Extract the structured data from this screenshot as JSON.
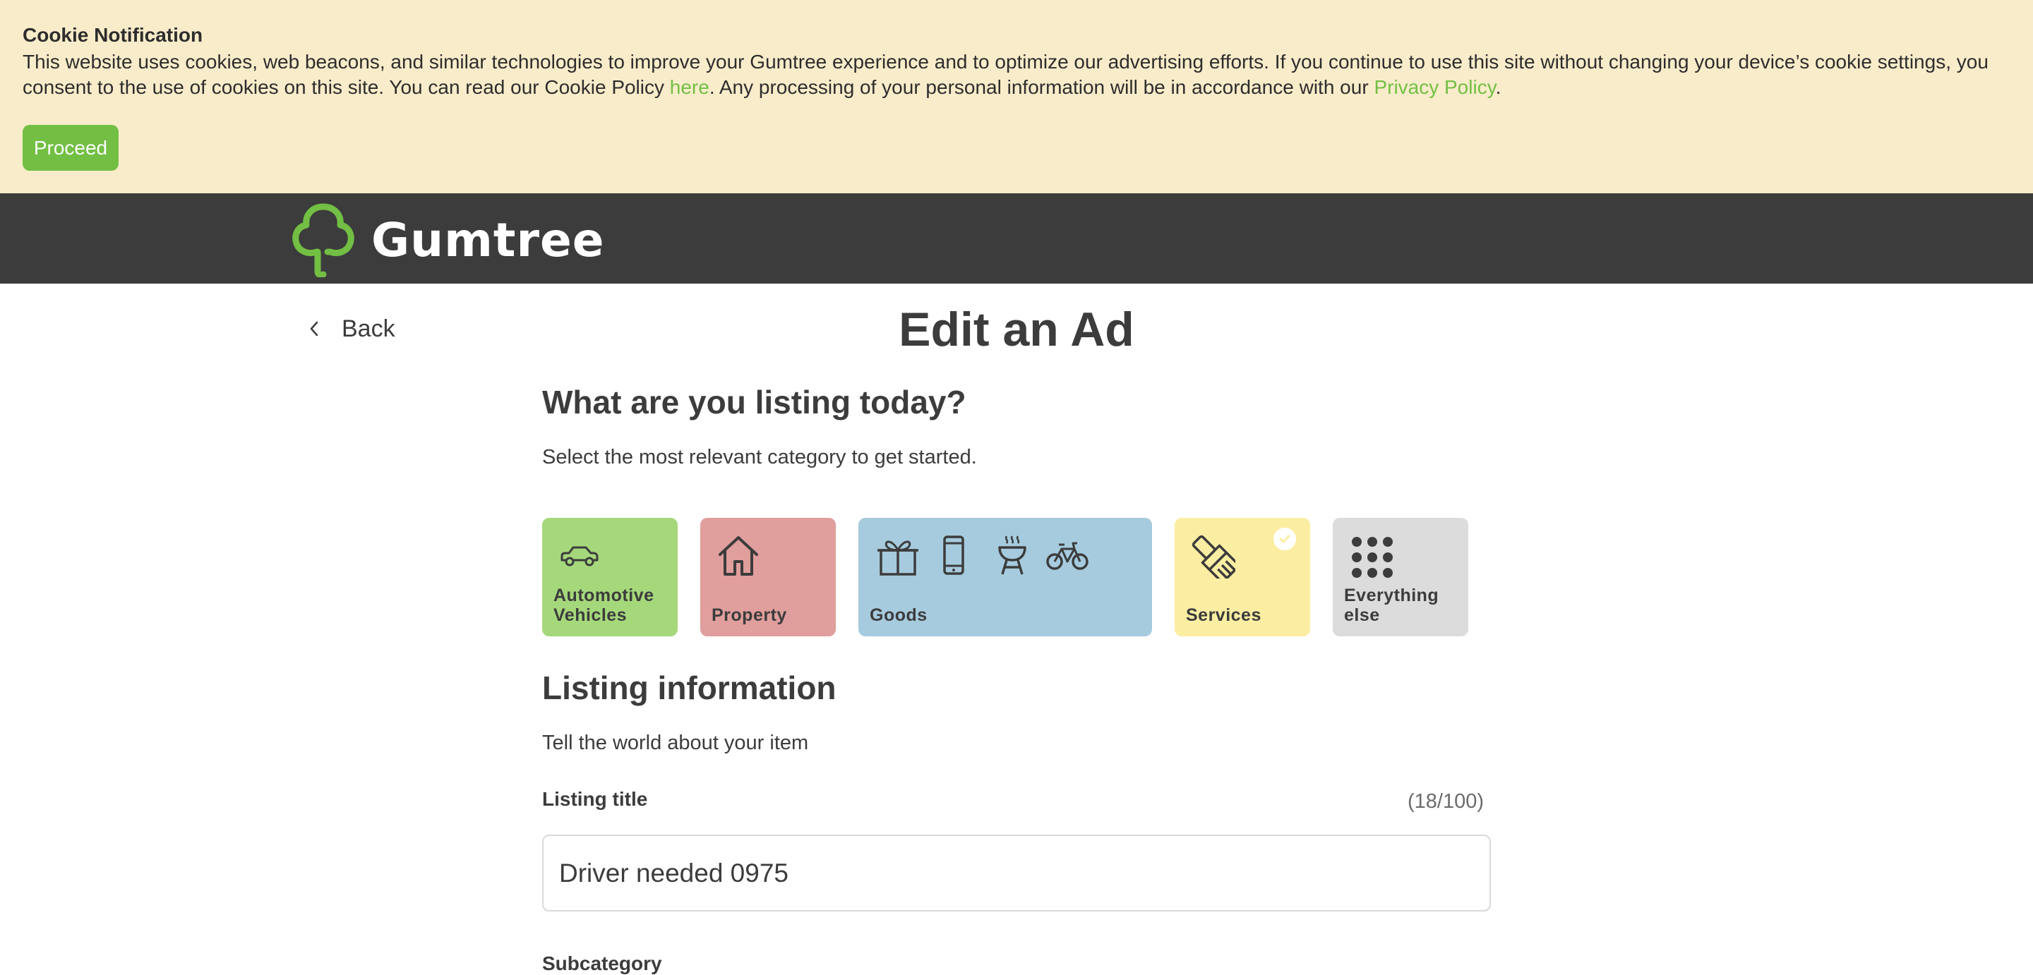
{
  "cookie": {
    "title": "Cookie Notification",
    "text_part1": "This website uses cookies, web beacons, and similar technologies to improve your Gumtree experience and to optimize our advertising efforts. If you continue to use this site without changing your device’s cookie settings, you consent to the use of cookies on this site. You can read our Cookie Policy ",
    "link_here": "here",
    "text_part2": ". Any processing of your personal information will be in accordance with our ",
    "link_privacy": "Privacy Policy",
    "text_part3": ".",
    "proceed_label": "Proceed"
  },
  "header": {
    "brand": "Gumtree",
    "logo_icon": "tree-logo-icon"
  },
  "nav": {
    "back_label": "Back"
  },
  "page": {
    "title": "Edit an Ad",
    "category_heading": "What are you listing today?",
    "category_sub": "Select the most relevant category to get started.",
    "listing_heading": "Listing information",
    "listing_sub": "Tell the world about your item"
  },
  "categories": [
    {
      "label_line1": "Automotive",
      "label_line2": "Vehicles",
      "color": "#a5d87b",
      "icon": "car-icon",
      "selected": false
    },
    {
      "label_line1": "Property",
      "label_line2": "",
      "color": "#e09e9c",
      "icon": "house-icon",
      "selected": false
    },
    {
      "label_line1": "Goods",
      "label_line2": "",
      "color": "#a6cbde",
      "icon": "goods-icons",
      "selected": false
    },
    {
      "label_line1": "Services",
      "label_line2": "",
      "color": "#fbeea2",
      "icon": "paintbrush-icon",
      "selected": true
    },
    {
      "label_line1": "Everything",
      "label_line2": "else",
      "color": "#dcdcdc",
      "icon": "dots-grid-icon",
      "selected": false
    }
  ],
  "form": {
    "title_label": "Listing title",
    "title_counter": "(18/100)",
    "title_value": "Driver needed 0975",
    "subcategory_label": "Subcategory"
  },
  "colors": {
    "brand_green": "#72bf44",
    "header_bg": "#3c3c3c",
    "cookie_bg": "#f9ecca"
  }
}
